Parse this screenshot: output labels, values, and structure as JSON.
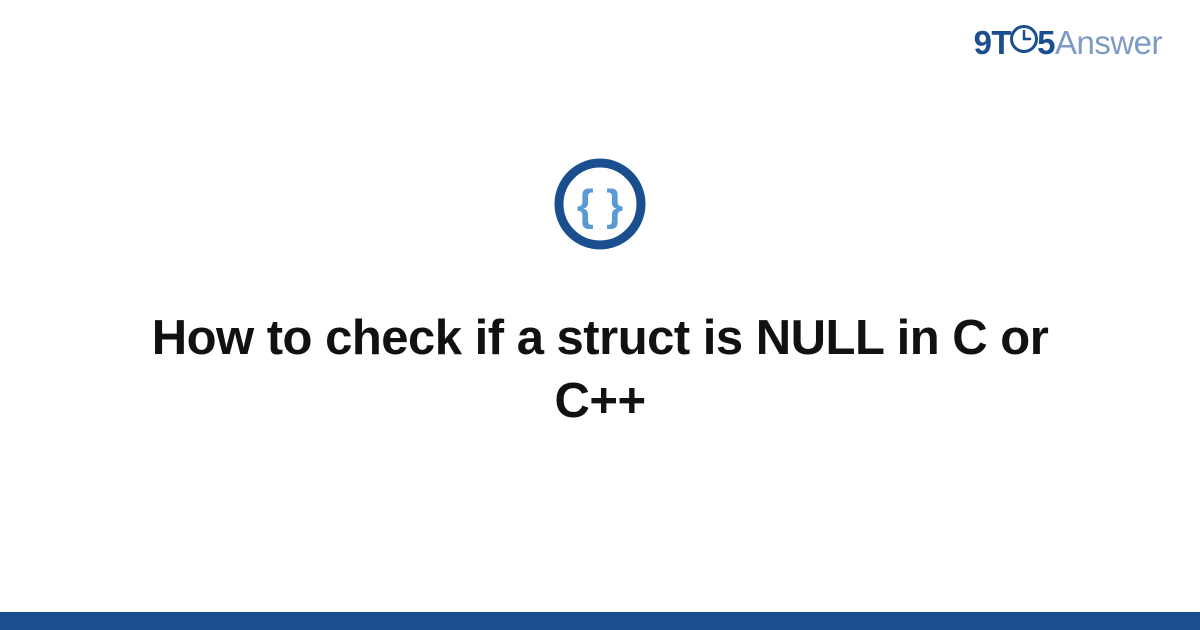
{
  "logo": {
    "part1": "9T",
    "part2": "5",
    "part3": "Answer"
  },
  "icon": {
    "name": "code-braces-icon",
    "ring_color": "#1a4e8e",
    "brace_color": "#5b9bd5"
  },
  "title": "How to check if a struct is NULL in C or C++",
  "accent_color": "#1a4e8e"
}
